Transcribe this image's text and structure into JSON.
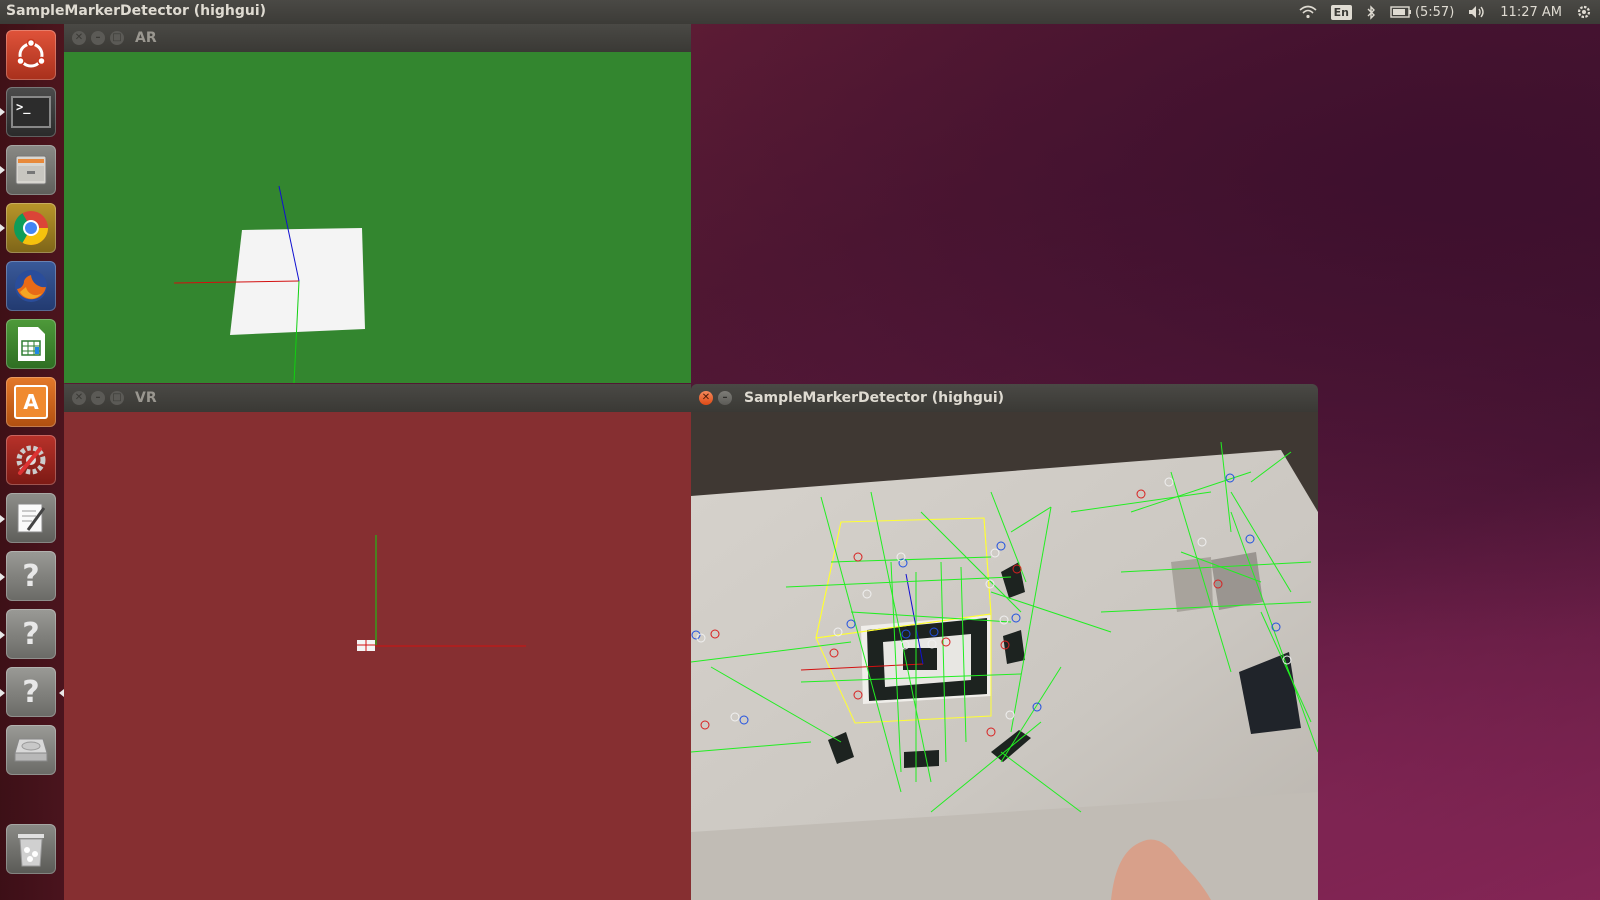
{
  "top_panel": {
    "title": "SampleMarkerDetector (highgui)",
    "keyboard_layout": "En",
    "battery": "(5:57)",
    "time": "11:27 AM"
  },
  "launcher": {
    "items": [
      {
        "name": "dash-home",
        "icon": "ubuntu-logo-icon"
      },
      {
        "name": "terminal",
        "icon": "terminal-icon",
        "glyph": ">_"
      },
      {
        "name": "files",
        "icon": "file-cabinet-icon"
      },
      {
        "name": "chrome",
        "icon": "chrome-icon"
      },
      {
        "name": "firefox",
        "icon": "firefox-icon"
      },
      {
        "name": "calc",
        "icon": "spreadsheet-icon"
      },
      {
        "name": "software-center",
        "icon": "shopping-bag-icon",
        "glyph": "A"
      },
      {
        "name": "system-settings",
        "icon": "wrench-gear-icon"
      },
      {
        "name": "text-editor",
        "icon": "text-editor-icon"
      },
      {
        "name": "unknown-app-1",
        "icon": "question-mark-icon",
        "glyph": "?"
      },
      {
        "name": "unknown-app-2",
        "icon": "question-mark-icon",
        "glyph": "?"
      },
      {
        "name": "unknown-app-3",
        "icon": "question-mark-icon",
        "glyph": "?"
      },
      {
        "name": "disk",
        "icon": "hard-disk-icon"
      },
      {
        "name": "trash",
        "icon": "trash-icon"
      }
    ]
  },
  "windows": {
    "ar": {
      "title": "AR",
      "bg": "#33862f"
    },
    "vr": {
      "title": "VR",
      "bg": "#862f31"
    },
    "detector": {
      "title": "SampleMarkerDetector (highgui)"
    }
  },
  "colors": {
    "axis_x": "#e01010",
    "axis_y": "#10e010",
    "axis_z": "#1010e0",
    "detect_line": "#00ff00",
    "box": "#ffff33"
  }
}
